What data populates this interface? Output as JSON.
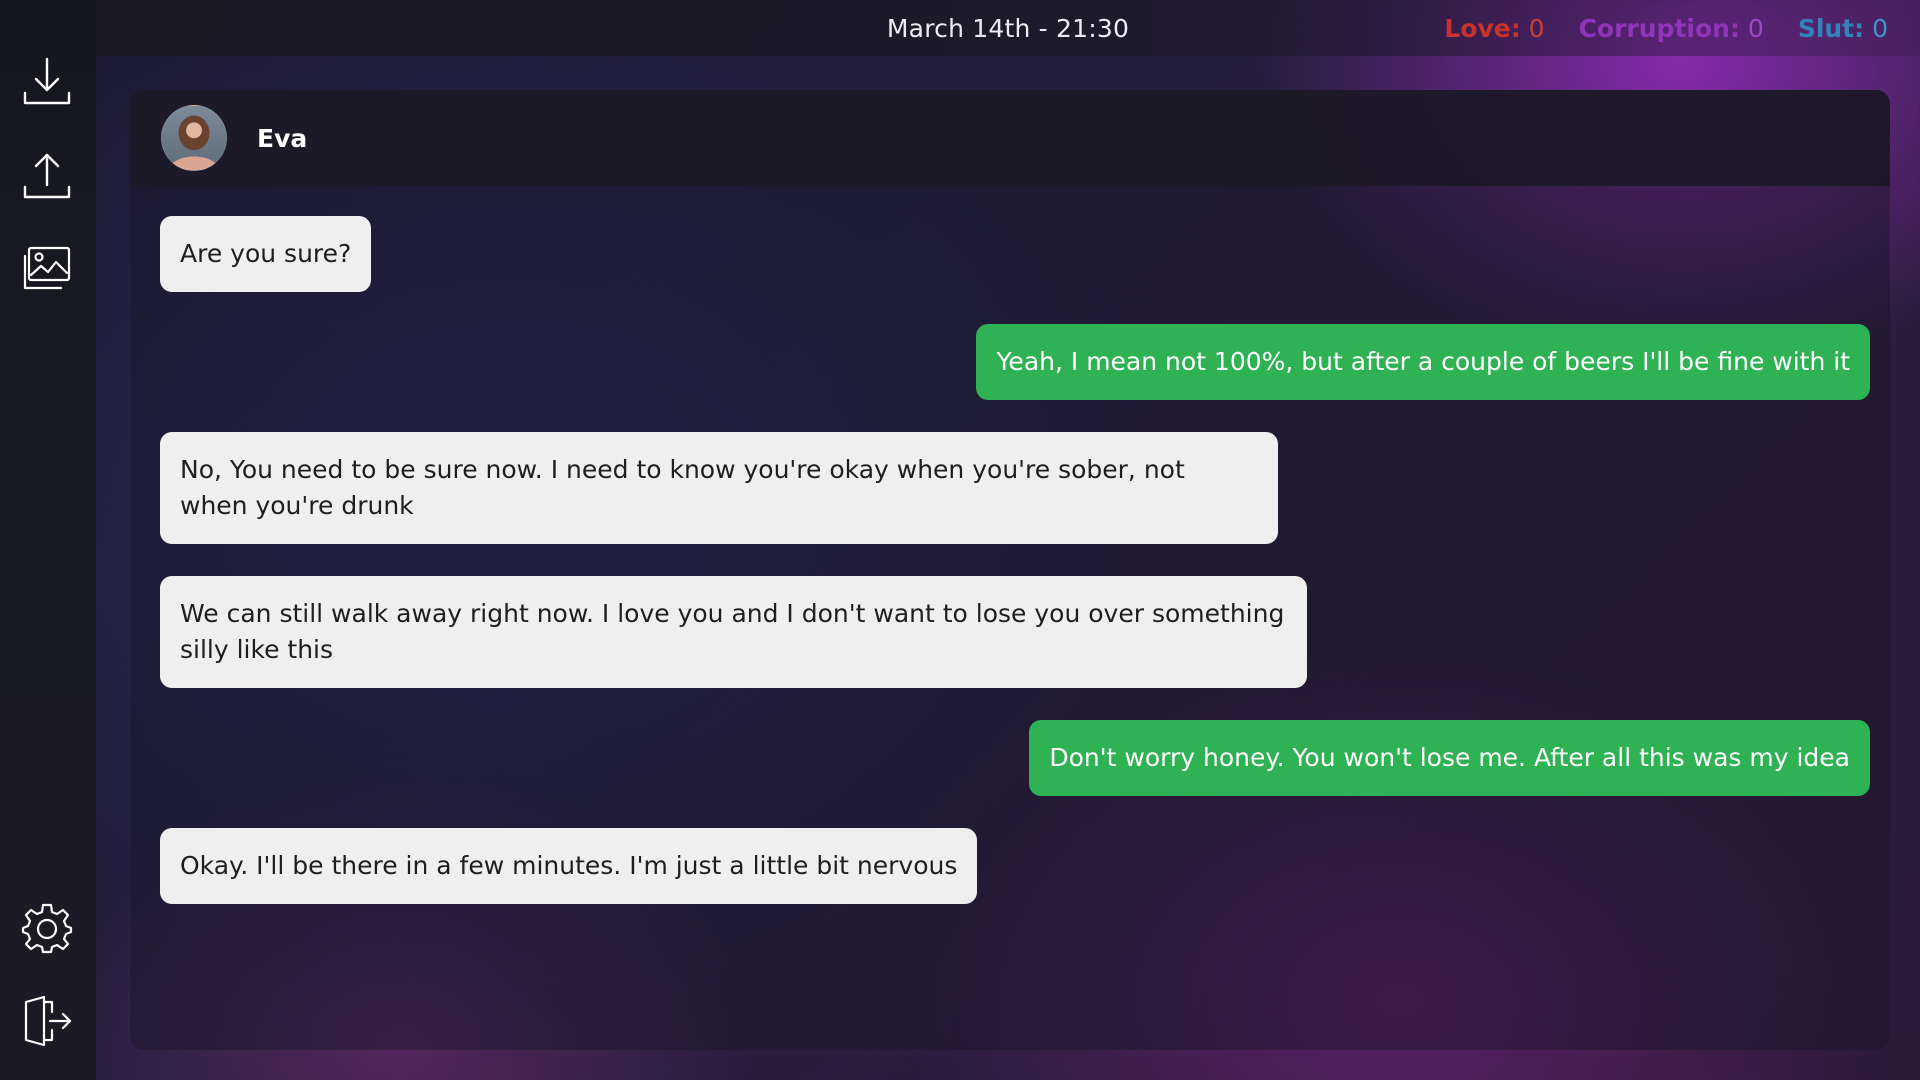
{
  "header": {
    "datetime": "March 14th - 21:30",
    "stats": [
      {
        "label": "Love:",
        "value": "0",
        "color": "#c8312c"
      },
      {
        "label": "Corruption:",
        "value": "0",
        "color": "#8e35b8"
      },
      {
        "label": "Slut:",
        "value": "0",
        "color": "#3382b8"
      }
    ]
  },
  "sidebar": {
    "items": [
      {
        "icon": "download-icon",
        "action": "save"
      },
      {
        "icon": "upload-icon",
        "action": "load"
      },
      {
        "icon": "gallery-icon",
        "action": "gallery"
      },
      {
        "icon": "gear-icon",
        "action": "settings"
      },
      {
        "icon": "exit-icon",
        "action": "exit"
      }
    ]
  },
  "chat": {
    "contact": {
      "name": "Eva",
      "avatar": "avatar-photo"
    },
    "messages": [
      {
        "from": "them",
        "text": "Are you sure?"
      },
      {
        "from": "me",
        "text": "Yeah, I mean not 100%, but after a couple of beers I'll be fine with it"
      },
      {
        "from": "them",
        "text": "No, You need to be sure now. I need to know you're okay when you're sober, not when you're drunk"
      },
      {
        "from": "them",
        "text": "We can still walk away right now. I love you and I don't want to lose you over something silly like this"
      },
      {
        "from": "me",
        "text": "Don't worry honey. You won't lose me. After all this was my idea"
      },
      {
        "from": "them",
        "text": "Okay. I'll be there in a few minutes. I'm just a little bit nervous"
      }
    ],
    "colors": {
      "incoming": "#efefef",
      "outgoing": "#2fb254"
    }
  }
}
